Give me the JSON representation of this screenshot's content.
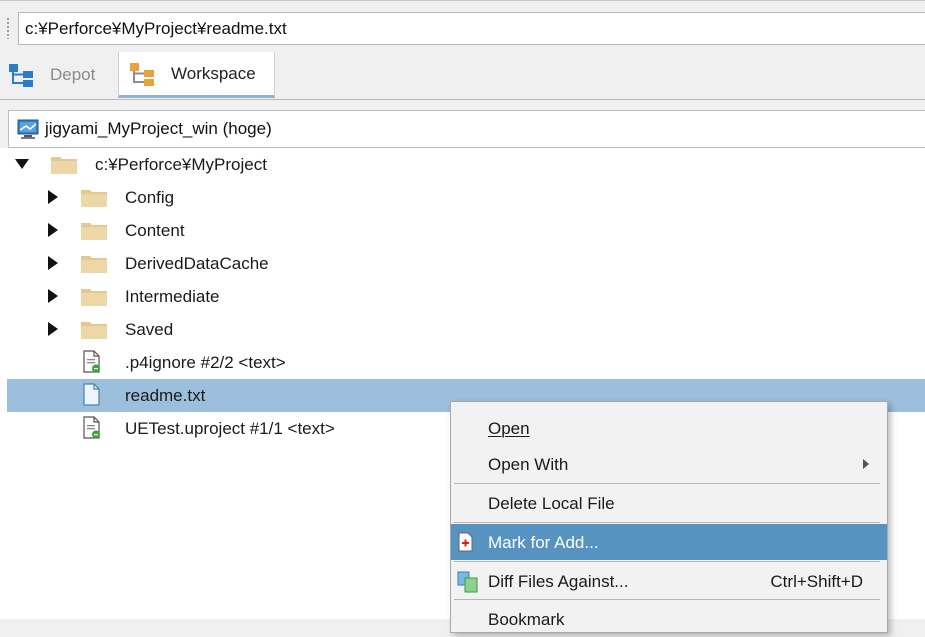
{
  "path_bar": {
    "value": "c:¥Perforce¥MyProject¥readme.txt"
  },
  "tabs": [
    {
      "label": "Depot",
      "icon": "depot-tree-icon",
      "active": false
    },
    {
      "label": "Workspace",
      "icon": "workspace-tree-icon",
      "active": true
    }
  ],
  "workspace": {
    "label": "jigyami_MyProject_win (hoge)",
    "icon": "workspace-computer-icon"
  },
  "tree": {
    "root": {
      "label": "c:¥Perforce¥MyProject",
      "expanded": true
    },
    "items": [
      {
        "label": "Config",
        "type": "folder"
      },
      {
        "label": "Content",
        "type": "folder"
      },
      {
        "label": "DerivedDataCache",
        "type": "folder"
      },
      {
        "label": "Intermediate",
        "type": "folder"
      },
      {
        "label": "Saved",
        "type": "folder"
      },
      {
        "label": ".p4ignore #2/2 <text>",
        "type": "depot-file"
      },
      {
        "label": "readme.txt",
        "type": "local-file",
        "selected": true
      },
      {
        "label": "UETest.uproject #1/1 <text>",
        "type": "depot-file"
      }
    ]
  },
  "context_menu": {
    "items": [
      {
        "label": "Open",
        "mnemonic": "O"
      },
      {
        "label": "Open With",
        "submenu": true
      },
      {
        "label": "Delete Local File",
        "mnemonic": "t"
      },
      {
        "label": "Mark for Add...",
        "mnemonic": "A",
        "highlighted": true,
        "icon": "mark-for-add-icon"
      },
      {
        "label": "Diff Files Against...",
        "mnemonic": "D",
        "shortcut": "Ctrl+Shift+D",
        "icon": "diff-icon"
      },
      {
        "label": "Bookmark"
      }
    ]
  },
  "colors": {
    "selection": "#9bbfdc",
    "menu_highlight": "#5793c0",
    "folder": "#e3c98f",
    "tab_accent": "#8fb3d4"
  }
}
